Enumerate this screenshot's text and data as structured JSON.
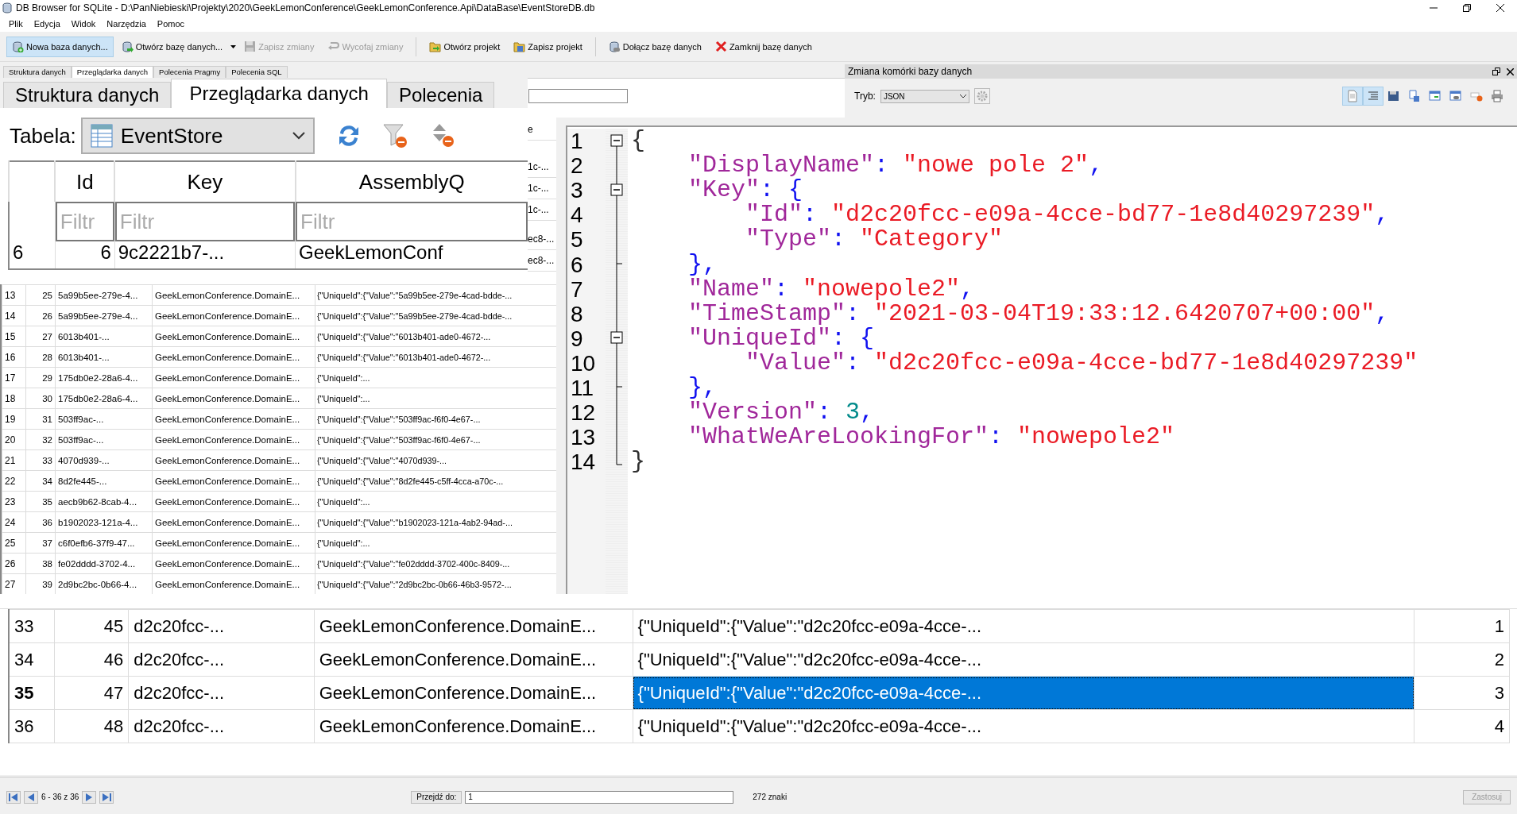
{
  "window": {
    "title": "DB Browser for SQLite - D:\\PanNiebieski\\Projekty\\2020\\GeekLemonConference\\GeekLemonConference.Api\\DataBase\\EventStoreDB.db"
  },
  "menu": [
    "Plik",
    "Edycja",
    "Widok",
    "Narzędzia",
    "Pomoc"
  ],
  "toolbar": [
    {
      "label": "Nowa baza danych...",
      "selected": true,
      "disabled": false
    },
    {
      "label": "Otwórz bazę danych...",
      "selected": false,
      "disabled": false
    },
    {
      "label": "Zapisz zmiany",
      "selected": false,
      "disabled": true
    },
    {
      "label": "Wycofaj zmiany",
      "selected": false,
      "disabled": true
    },
    {
      "label": "Otwórz projekt",
      "selected": false,
      "disabled": false
    },
    {
      "label": "Zapisz projekt",
      "selected": false,
      "disabled": false
    },
    {
      "label": "Dołącz bazę danych",
      "selected": false,
      "disabled": false
    },
    {
      "label": "Zamknij bazę danych",
      "selected": false,
      "disabled": false
    }
  ],
  "tabs": [
    {
      "label": "Struktura danych",
      "selected": false
    },
    {
      "label": "Przeglądarka danych",
      "selected": true
    },
    {
      "label": "Polecenia Pragmy",
      "selected": false
    },
    {
      "label": "Polecenia SQL",
      "selected": false
    }
  ],
  "browse": {
    "tabs": [
      {
        "label": "Struktura danych",
        "selected": false
      },
      {
        "label": "Przeglądarka danych",
        "selected": true
      },
      {
        "label": "Polecenia",
        "selected": false
      }
    ],
    "table_label": "Tabela:",
    "table": "EventStore",
    "columns": [
      "Id",
      "Key",
      "AssemblyQ"
    ],
    "filters": [
      {
        "placeholder": "Filtr"
      },
      {
        "placeholder": "Filtr"
      },
      {
        "placeholder": "Filtr"
      }
    ],
    "partial_row": [
      "6",
      "6",
      "9c2221b7-...",
      "GeekLemonConf"
    ]
  },
  "fragments": [
    "e",
    "1c-...",
    "1c-...",
    "1c-...",
    "ec8-...",
    "ec8-..."
  ],
  "editor_dock": {
    "title": "Zmiana komórki bazy danych",
    "mode_label": "Tryb:",
    "mode": "JSON",
    "tools": [
      {
        "selected": true
      },
      {
        "selected": true
      },
      {
        "selected": false
      },
      {
        "selected": false
      },
      {
        "selected": false
      },
      {
        "selected": false
      },
      {
        "selected": false
      },
      {
        "selected": false
      }
    ]
  },
  "json_editor": {
    "lines": [
      {
        "number": "1",
        "kind": "start",
        "tokens": [
          {
            "kind": "plain",
            "text": "{"
          }
        ]
      },
      {
        "number": "2",
        "kind": "mid",
        "tokens": [
          {
            "kind": "key",
            "text": "    \"DisplayName\""
          },
          {
            "kind": "punct",
            "text": ": "
          },
          {
            "kind": "string",
            "text": "\"nowe pole 2\""
          },
          {
            "kind": "punct",
            "text": ","
          }
        ]
      },
      {
        "number": "3",
        "kind": "start",
        "tokens": [
          {
            "kind": "key",
            "text": "    \"Key\""
          },
          {
            "kind": "punct",
            "text": ": {"
          }
        ]
      },
      {
        "number": "4",
        "kind": "mid",
        "tokens": [
          {
            "kind": "key",
            "text": "        \"Id\""
          },
          {
            "kind": "punct",
            "text": ": "
          },
          {
            "kind": "string",
            "text": "\"d2c20fcc-e09a-4cce-bd77-1e8d40297239\""
          },
          {
            "kind": "punct",
            "text": ","
          }
        ]
      },
      {
        "number": "5",
        "kind": "mid",
        "tokens": [
          {
            "kind": "key",
            "text": "        \"Type\""
          },
          {
            "kind": "punct",
            "text": ": "
          },
          {
            "kind": "string",
            "text": "\"Category\""
          }
        ]
      },
      {
        "number": "6",
        "kind": "end",
        "tokens": [
          {
            "kind": "punct",
            "text": "    },"
          }
        ]
      },
      {
        "number": "7",
        "kind": "mid",
        "tokens": [
          {
            "kind": "key",
            "text": "    \"Name\""
          },
          {
            "kind": "punct",
            "text": ": "
          },
          {
            "kind": "string",
            "text": "\"nowepole2\""
          },
          {
            "kind": "punct",
            "text": ","
          }
        ]
      },
      {
        "number": "8",
        "kind": "mid",
        "tokens": [
          {
            "kind": "key",
            "text": "    \"TimeStamp\""
          },
          {
            "kind": "punct",
            "text": ": "
          },
          {
            "kind": "string",
            "text": "\"2021-03-04T19:33:12.6420707+00:00\""
          },
          {
            "kind": "punct",
            "text": ","
          }
        ]
      },
      {
        "number": "9",
        "kind": "start",
        "tokens": [
          {
            "kind": "key",
            "text": "    \"UniqueId\""
          },
          {
            "kind": "punct",
            "text": ": {"
          }
        ]
      },
      {
        "number": "10",
        "kind": "mid",
        "tokens": [
          {
            "kind": "key",
            "text": "        \"Value\""
          },
          {
            "kind": "punct",
            "text": ": "
          },
          {
            "kind": "string",
            "text": "\"d2c20fcc-e09a-4cce-bd77-1e8d40297239\""
          }
        ]
      },
      {
        "number": "11",
        "kind": "end",
        "tokens": [
          {
            "kind": "punct",
            "text": "    },"
          }
        ]
      },
      {
        "number": "12",
        "kind": "mid",
        "tokens": [
          {
            "kind": "key",
            "text": "    \"Version\""
          },
          {
            "kind": "punct",
            "text": ": "
          },
          {
            "kind": "number",
            "text": "3"
          },
          {
            "kind": "punct",
            "text": ","
          }
        ]
      },
      {
        "number": "13",
        "kind": "mid",
        "tokens": [
          {
            "kind": "key",
            "text": "    \"WhatWeAreLookingFor\""
          },
          {
            "kind": "punct",
            "text": ": "
          },
          {
            "kind": "string",
            "text": "\"nowepole2\""
          }
        ]
      },
      {
        "number": "14",
        "kind": "last",
        "tokens": [
          {
            "kind": "plain",
            "text": "}"
          }
        ]
      }
    ]
  },
  "small_grid": {
    "rows": [
      {
        "row": "13",
        "cells": [
          "25",
          "5a99b5ee-279e-4...",
          "GeekLemonConference.DomainE...",
          "{\"UniqueId\":{\"Value\":\"5a99b5ee-279e-4cad-bdde-..."
        ]
      },
      {
        "row": "14",
        "cells": [
          "26",
          "5a99b5ee-279e-4...",
          "GeekLemonConference.DomainE...",
          "{\"UniqueId\":{\"Value\":\"5a99b5ee-279e-4cad-bdde-..."
        ]
      },
      {
        "row": "15",
        "cells": [
          "27",
          "6013b401-...",
          "GeekLemonConference.DomainE...",
          "{\"UniqueId\":{\"Value\":\"6013b401-ade0-4672-..."
        ]
      },
      {
        "row": "16",
        "cells": [
          "28",
          "6013b401-...",
          "GeekLemonConference.DomainE...",
          "{\"UniqueId\":{\"Value\":\"6013b401-ade0-4672-..."
        ]
      },
      {
        "row": "17",
        "cells": [
          "29",
          "175db0e2-28a6-4...",
          "GeekLemonConference.DomainE...",
          "{\"UniqueId\":..."
        ]
      },
      {
        "row": "18",
        "cells": [
          "30",
          "175db0e2-28a6-4...",
          "GeekLemonConference.DomainE...",
          "{\"UniqueId\":..."
        ]
      },
      {
        "row": "19",
        "cells": [
          "31",
          "503ff9ac-...",
          "GeekLemonConference.DomainE...",
          "{\"UniqueId\":{\"Value\":\"503ff9ac-f6f0-4e67-..."
        ]
      },
      {
        "row": "20",
        "cells": [
          "32",
          "503ff9ac-...",
          "GeekLemonConference.DomainE...",
          "{\"UniqueId\":{\"Value\":\"503ff9ac-f6f0-4e67-..."
        ]
      },
      {
        "row": "21",
        "cells": [
          "33",
          "4070d939-...",
          "GeekLemonConference.DomainE...",
          "{\"UniqueId\":{\"Value\":\"4070d939-..."
        ]
      },
      {
        "row": "22",
        "cells": [
          "34",
          "8d2fe445-...",
          "GeekLemonConference.DomainE...",
          "{\"UniqueId\":{\"Value\":\"8d2fe445-c5ff-4cca-a70c-..."
        ]
      },
      {
        "row": "23",
        "cells": [
          "35",
          "aecb9b62-8cab-4...",
          "GeekLemonConference.DomainE...",
          "{\"UniqueId\":..."
        ]
      },
      {
        "row": "24",
        "cells": [
          "36",
          "b1902023-121a-4...",
          "GeekLemonConference.DomainE...",
          "{\"UniqueId\":{\"Value\":\"b1902023-121a-4ab2-94ad-..."
        ]
      },
      {
        "row": "25",
        "cells": [
          "37",
          "c6f0efb6-37f9-47...",
          "GeekLemonConference.DomainE...",
          "{\"UniqueId\":..."
        ]
      },
      {
        "row": "26",
        "cells": [
          "38",
          "fe02dddd-3702-4...",
          "GeekLemonConference.DomainE...",
          "{\"UniqueId\":{\"Value\":\"fe02dddd-3702-400c-8409-..."
        ]
      },
      {
        "row": "27",
        "cells": [
          "39",
          "2d9bc2bc-0b66-4...",
          "GeekLemonConference.DomainE...",
          "{\"UniqueId\":{\"Value\":\"2d9bc2bc-0b66-46b3-9572-..."
        ]
      }
    ]
  },
  "big_grid": {
    "rows": [
      {
        "row": "33",
        "selected": false,
        "cells": [
          {
            "text": "45",
            "selected": false
          },
          {
            "text": "d2c20fcc-...",
            "selected": false
          },
          {
            "text": "GeekLemonConference.DomainE...",
            "selected": false
          },
          {
            "text": "{\"UniqueId\":{\"Value\":\"d2c20fcc-e09a-4cce-...",
            "selected": false
          },
          {
            "text": "1",
            "selected": false
          }
        ]
      },
      {
        "row": "34",
        "selected": false,
        "cells": [
          {
            "text": "46",
            "selected": false
          },
          {
            "text": "d2c20fcc-...",
            "selected": false
          },
          {
            "text": "GeekLemonConference.DomainE...",
            "selected": false
          },
          {
            "text": "{\"UniqueId\":{\"Value\":\"d2c20fcc-e09a-4cce-...",
            "selected": false
          },
          {
            "text": "2",
            "selected": false
          }
        ]
      },
      {
        "row": "35",
        "selected": true,
        "cells": [
          {
            "text": "47",
            "selected": false
          },
          {
            "text": "d2c20fcc-...",
            "selected": false
          },
          {
            "text": "GeekLemonConference.DomainE...",
            "selected": false
          },
          {
            "text": "{\"UniqueId\":{\"Value\":\"d2c20fcc-e09a-4cce-...",
            "selected": true
          },
          {
            "text": "3",
            "selected": false
          }
        ]
      },
      {
        "row": "36",
        "selected": false,
        "cells": [
          {
            "text": "48",
            "selected": false
          },
          {
            "text": "d2c20fcc-...",
            "selected": false
          },
          {
            "text": "GeekLemonConference.DomainE...",
            "selected": false
          },
          {
            "text": "{\"UniqueId\":{\"Value\":\"d2c20fcc-e09a-4cce-...",
            "selected": false
          },
          {
            "text": "4",
            "selected": false
          }
        ]
      }
    ]
  },
  "navigator": {
    "range": "6 - 36 z 36",
    "goto_label": "Przejdź do:",
    "goto_value": "1",
    "char_count": "272 znaki",
    "apply": {
      "label": "Zastosuj",
      "disabled": true
    }
  }
}
